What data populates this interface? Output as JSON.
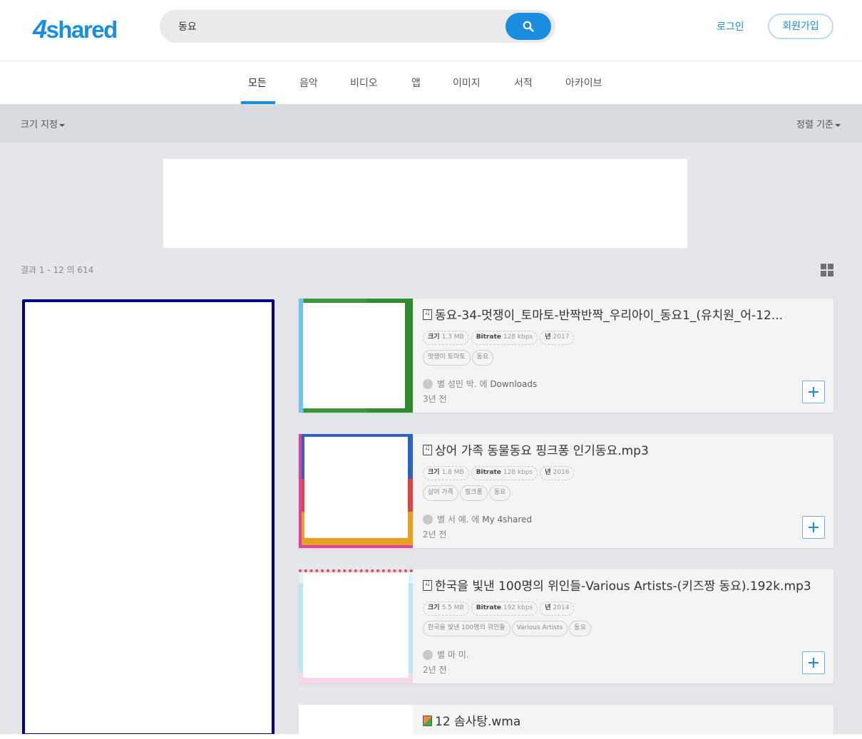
{
  "header": {
    "logo": "4shared",
    "search_value": "동요",
    "login": "로그인",
    "signup": "회원가입"
  },
  "tabs": [
    {
      "label": "모든",
      "active": true
    },
    {
      "label": "음악"
    },
    {
      "label": "비디오"
    },
    {
      "label": "앱"
    },
    {
      "label": "이미지"
    },
    {
      "label": "서적"
    },
    {
      "label": "아카이브"
    }
  ],
  "filters": {
    "size": "크기 지정",
    "sort": "정렬 기준"
  },
  "results_count": "결과 1 - 12 의 614",
  "results": [
    {
      "title": "동요-34-멋쟁이_토마토-반짝반짝_우리아이_동요1_(유치원_어-12...",
      "size_label": "크기",
      "size": "1.3 MB",
      "bitrate_label": "Bitrate",
      "bitrate": "128 kbps",
      "year_label": "년",
      "year": "2017",
      "tags": [
        "멋쟁이 토마토",
        "동요"
      ],
      "by": "별 성민 박.",
      "in": "에",
      "folder": "Downloads",
      "time": "3년 전"
    },
    {
      "title": "상어 가족 동물동요 핑크퐁 인기동요.mp3",
      "size_label": "크기",
      "size": "1.8 MB",
      "bitrate_label": "Bitrate",
      "bitrate": "128 kbps",
      "year_label": "년",
      "year": "2016",
      "tags": [
        "상어 가족",
        "핑크퐁",
        "동요"
      ],
      "by": "별 서 예.",
      "in": "에",
      "folder": "My 4shared",
      "time": "2년 전"
    },
    {
      "title": "한국을 빛낸 100명의 위인들-Various Artists-(키즈짱 동요).192k.mp3",
      "size_label": "크기",
      "size": "5.5 MB",
      "bitrate_label": "Bitrate",
      "bitrate": "192 kbps",
      "year_label": "년",
      "year": "2014",
      "tags": [
        "한국을 빛낸 100명의 위인들",
        "Various Artists",
        "동요"
      ],
      "by": "별 마 미.",
      "in": "",
      "folder": "",
      "time": "2년 전"
    },
    {
      "title": "12 솜사탕.wma"
    }
  ]
}
